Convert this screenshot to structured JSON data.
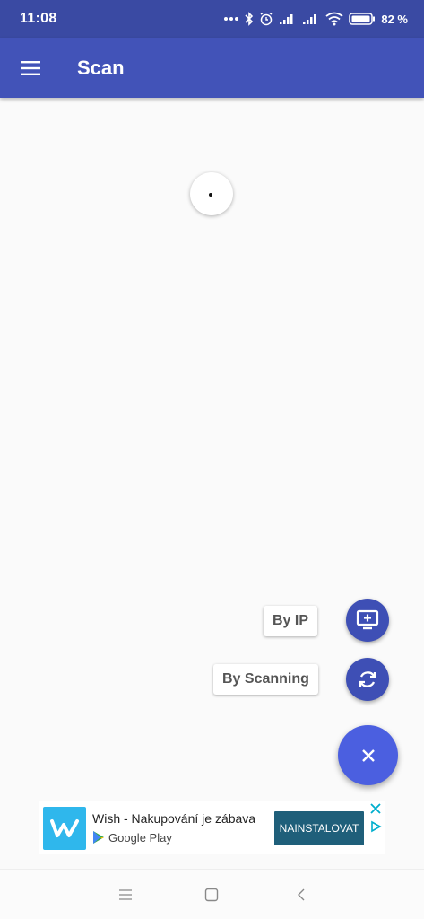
{
  "status_bar": {
    "time": "11:08",
    "battery_percent": "82 %",
    "icons": [
      "more-dots-icon",
      "bluetooth-icon",
      "alarm-icon",
      "signal-icon",
      "signal-icon",
      "wifi-icon",
      "battery-icon"
    ]
  },
  "app_bar": {
    "title": "Scan",
    "menu_icon": "hamburger-menu-icon"
  },
  "fab_menu": {
    "actions": [
      {
        "label": "By IP",
        "icon": "add-to-screen-icon"
      },
      {
        "label": "By Scanning",
        "icon": "refresh-icon"
      }
    ],
    "close_icon": "close-icon"
  },
  "ad": {
    "title": "Wish - Nakupování je zábava",
    "store": "Google Play",
    "cta": "NAINSTALOVAT"
  },
  "colors": {
    "status_bar": "#3a4aa3",
    "app_bar": "#4253b8",
    "mini_fab": "#3e4fb5",
    "main_fab": "#4b5fe0",
    "ad_cta": "#1f5f7a",
    "ad_logo": "#2fb7ec"
  }
}
